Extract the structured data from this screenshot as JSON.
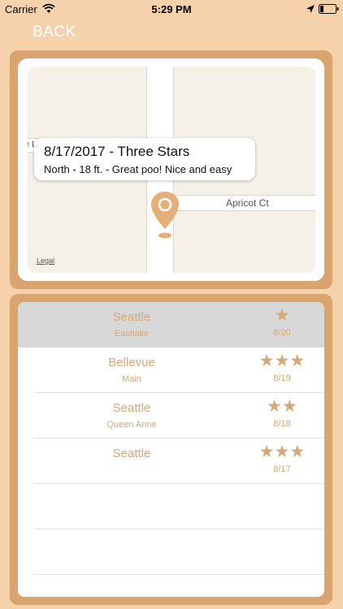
{
  "status_bar": {
    "carrier": "Carrier",
    "time": "5:29 PM"
  },
  "nav": {
    "back_label": "BACK"
  },
  "map": {
    "callout_title": "8/17/2017 - Three Stars",
    "callout_subtitle": "North - 18 ft. - Great poo! Nice and easy",
    "street_label": "Apricot Ct",
    "left_street_fragment": "e L",
    "legal_label": "Legal"
  },
  "list": {
    "rows": [
      {
        "city": "Seattle",
        "neighborhood": "Eastlake",
        "stars": "★",
        "date": "8/20",
        "selected": true
      },
      {
        "city": "Bellevue",
        "neighborhood": "Main",
        "stars": "★★★",
        "date": "8/19",
        "selected": false
      },
      {
        "city": "Seattle",
        "neighborhood": "Queen Anne",
        "stars": "★★",
        "date": "8/18",
        "selected": false
      },
      {
        "city": "Seattle",
        "neighborhood": "",
        "stars": "★★★",
        "date": "8/17",
        "selected": false
      }
    ]
  },
  "colors": {
    "background": "#f5d2ab",
    "frame": "#d9a46f",
    "accent_text": "#d6a877",
    "selected_row": "#d8d8d8"
  }
}
